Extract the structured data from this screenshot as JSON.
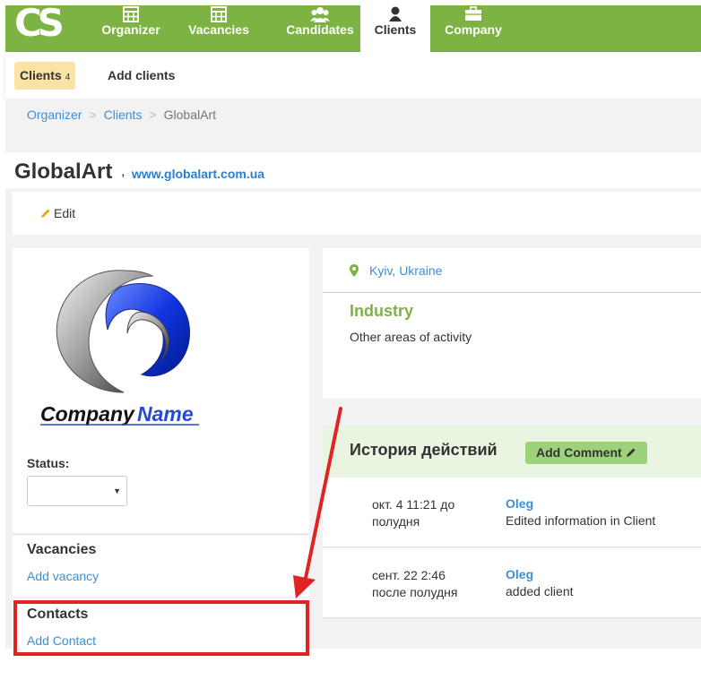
{
  "app": {
    "logo_text": "CS"
  },
  "nav": {
    "items": [
      {
        "label": "Organizer",
        "icon": "calendar-icon"
      },
      {
        "label": "Vacancies",
        "icon": "calendar-icon"
      },
      {
        "label": "Candidates",
        "icon": "users-icon"
      },
      {
        "label": "Clients",
        "icon": "user-icon",
        "active": true
      },
      {
        "label": "Company",
        "icon": "briefcase-icon"
      }
    ]
  },
  "subnav": {
    "clients_label": "Clients",
    "clients_count": "4",
    "add_clients_label": "Add clients"
  },
  "breadcrumb": {
    "items": [
      "Organizer",
      "Clients",
      "GlobalArt"
    ],
    "separator": ">"
  },
  "client": {
    "name": "GlobalArt",
    "separator": ",",
    "website": "www.globalart.com.ua",
    "edit_label": "Edit",
    "logo_text_1": "Company",
    "logo_text_2": "Name",
    "status_label": "Status:",
    "status_value": "",
    "location": "Kyiv, Ukraine",
    "industry_label": "Industry",
    "industry_value": "Other areas of activity"
  },
  "vacancies": {
    "title": "Vacancies",
    "add_label": "Add vacancy"
  },
  "contacts": {
    "title": "Contacts",
    "add_label": "Add Contact"
  },
  "history": {
    "title": "История действий",
    "add_comment_label": "Add Comment",
    "rows": [
      {
        "date_line1": "окт. 4 11:21 до",
        "date_line2": "полудня",
        "user": "Oleg",
        "action": "Edited information in Client"
      },
      {
        "date_line1": "сент. 22 2:46",
        "date_line2": "после полудня",
        "user": "Oleg",
        "action": "added client"
      }
    ]
  },
  "colors": {
    "brand_green": "#7cb342",
    "link_blue": "#3a8fd8",
    "highlight_red": "#e02424",
    "pill_yellow": "#fbe3a5"
  }
}
